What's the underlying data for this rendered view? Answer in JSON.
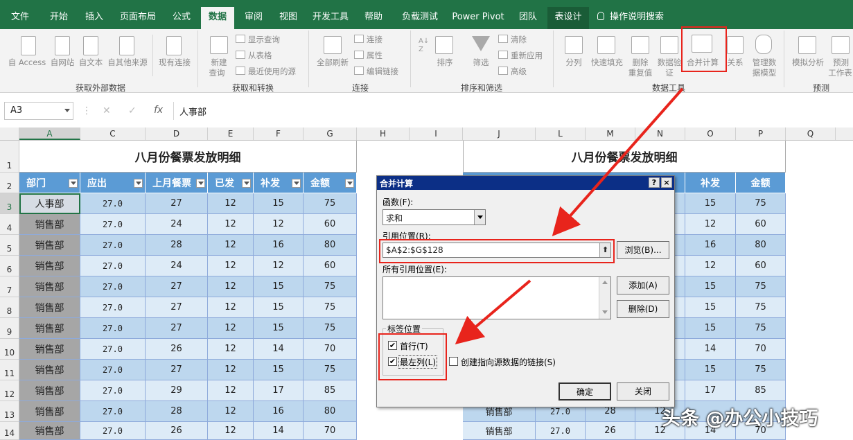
{
  "tabs": [
    "文件",
    "开始",
    "插入",
    "页面布局",
    "公式",
    "数据",
    "审阅",
    "视图",
    "开发工具",
    "帮助",
    "负载测试",
    "Power Pivot",
    "团队",
    "表设计",
    "操作说明搜索"
  ],
  "ribbon": {
    "ext": [
      "自 Access",
      "自网站",
      "自文本",
      "自其他来源",
      "现有连接"
    ],
    "transform_big": [
      "新建",
      "查询"
    ],
    "transform_small": [
      "显示查询",
      "从表格",
      "最近使用的源"
    ],
    "refresh": "全部刷新",
    "conn_small": [
      "连接",
      "属性",
      "编辑链接"
    ],
    "sort": "排序",
    "filter": "筛选",
    "filter_small": [
      "清除",
      "重新应用",
      "高级"
    ],
    "tools": [
      "分列",
      "快速填充",
      "删除",
      "重复值",
      "数据验",
      "证",
      "合并计算",
      "关系",
      "管理数",
      "据模型"
    ],
    "forecast": [
      "模拟分析",
      "预测",
      "工作表"
    ],
    "groups": [
      "获取外部数据",
      "获取和转换",
      "连接",
      "排序和筛选",
      "数据工具",
      "预测"
    ]
  },
  "formula": {
    "namebox": "A3",
    "fx": "fx",
    "value": "人事部"
  },
  "columns": [
    "A",
    "C",
    "D",
    "E",
    "F",
    "G",
    "H",
    "I",
    "J",
    "L",
    "M",
    "N",
    "O",
    "P",
    "Q"
  ],
  "rows": [
    "1",
    "2",
    "3",
    "4",
    "5",
    "6",
    "7",
    "8",
    "9",
    "10",
    "11",
    "12",
    "13",
    "14"
  ],
  "left_table": {
    "title": "八月份餐票发放明细",
    "headers": [
      "部门",
      "应出",
      "上月餐票",
      "已发",
      "补发",
      "金额"
    ],
    "rows": [
      [
        "人事部",
        "27.0",
        "27",
        "12",
        "15",
        "75"
      ],
      [
        "销售部",
        "27.0",
        "24",
        "12",
        "12",
        "60"
      ],
      [
        "销售部",
        "27.0",
        "28",
        "12",
        "16",
        "80"
      ],
      [
        "销售部",
        "27.0",
        "24",
        "12",
        "12",
        "60"
      ],
      [
        "销售部",
        "27.0",
        "27",
        "12",
        "15",
        "75"
      ],
      [
        "销售部",
        "27.0",
        "27",
        "12",
        "15",
        "75"
      ],
      [
        "销售部",
        "27.0",
        "27",
        "12",
        "15",
        "75"
      ],
      [
        "销售部",
        "27.0",
        "26",
        "12",
        "14",
        "70"
      ],
      [
        "销售部",
        "27.0",
        "27",
        "12",
        "15",
        "75"
      ],
      [
        "销售部",
        "27.0",
        "29",
        "12",
        "17",
        "85"
      ],
      [
        "销售部",
        "27.0",
        "28",
        "12",
        "16",
        "80"
      ],
      [
        "销售部",
        "27.0",
        "26",
        "12",
        "14",
        "70"
      ]
    ]
  },
  "right_table": {
    "title": "八月份餐票发放明细",
    "headers": [
      "补发",
      "金额"
    ],
    "rows": [
      [
        "15",
        "75"
      ],
      [
        "12",
        "60"
      ],
      [
        "16",
        "80"
      ],
      [
        "12",
        "60"
      ],
      [
        "15",
        "75"
      ],
      [
        "15",
        "75"
      ],
      [
        "15",
        "75"
      ],
      [
        "14",
        "70"
      ],
      [
        "15",
        "75"
      ],
      [
        "17",
        "85"
      ]
    ],
    "row13": [
      "销售部",
      "27.0",
      "28",
      "12"
    ],
    "row14": [
      "销售部",
      "27.0",
      "26",
      "12",
      "14",
      "70"
    ]
  },
  "dialog": {
    "title": "合并计算",
    "help": "?",
    "close": "×",
    "function_label": "函数(F):",
    "function_value": "求和",
    "ref_label": "引用位置(R):",
    "ref_value": "$A$2:$G$128",
    "browse": "浏览(B)...",
    "all_refs_label": "所有引用位置(E):",
    "add": "添加(A)",
    "delete": "删除(D)",
    "label_group": "标签位置",
    "top_row": "首行(T)",
    "left_col": "最左列(L)",
    "link": "创建指向源数据的链接(S)",
    "ok": "确定",
    "close_btn": "关闭"
  },
  "watermark": "头条 @办公小技巧",
  "colors": {
    "excel_green": "#217346",
    "header_blue": "#5b9bd5",
    "dialog_title": "#0c2f86",
    "highlight_red": "#e8241c"
  }
}
